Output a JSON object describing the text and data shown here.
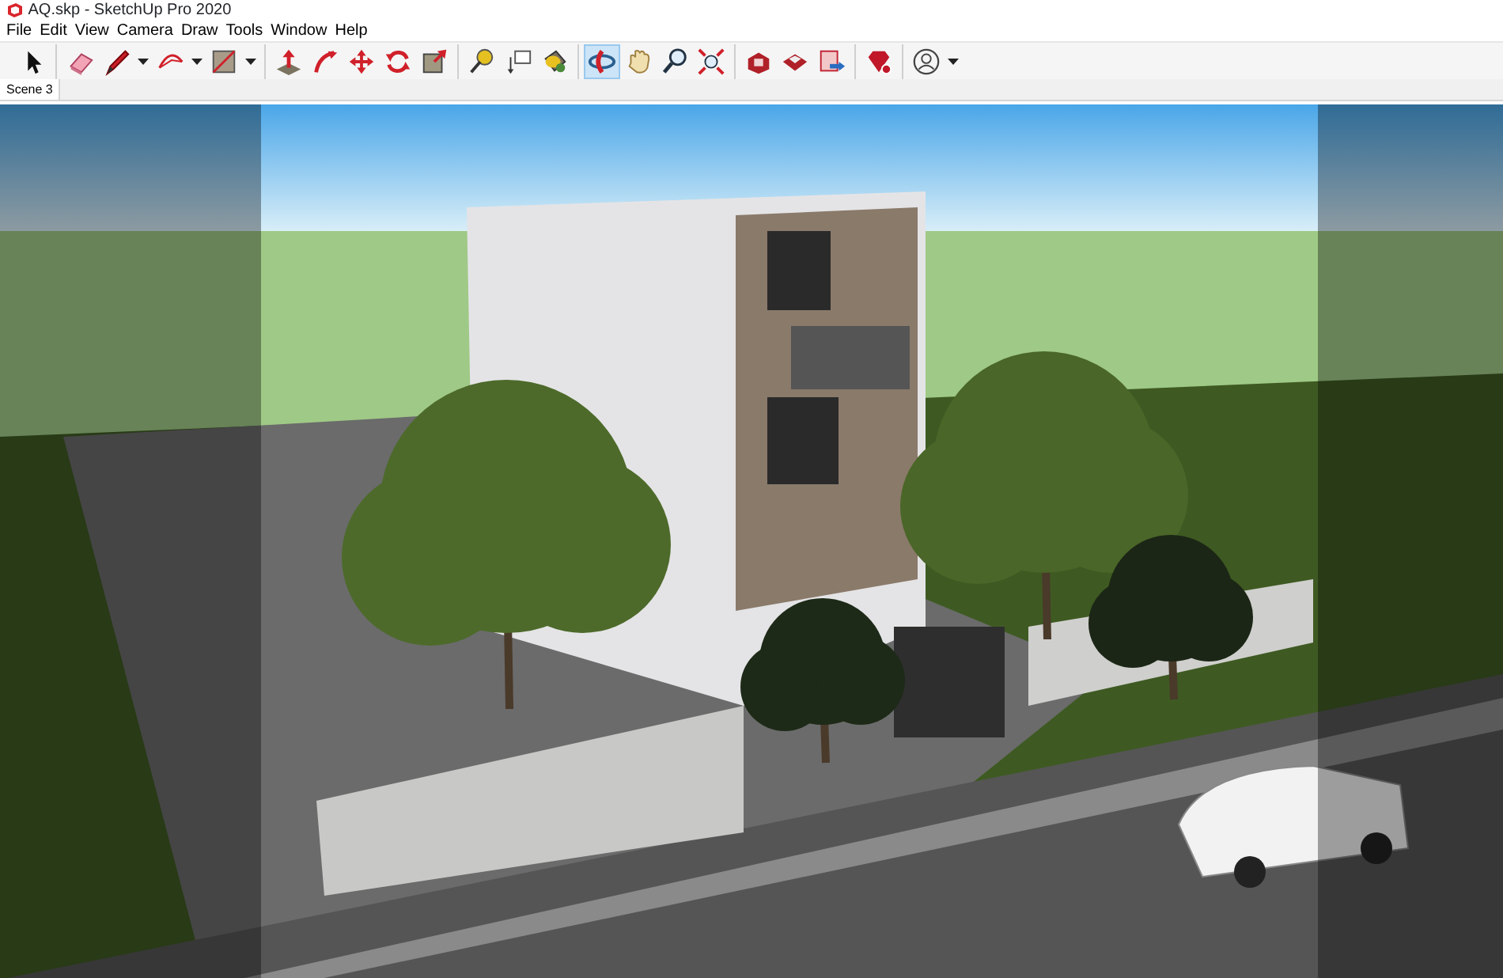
{
  "window": {
    "title": "AQ.skp - SketchUp Pro 2020"
  },
  "menu": [
    "File",
    "Edit",
    "View",
    "Camera",
    "Draw",
    "Tools",
    "Window",
    "Help"
  ],
  "toolbar": [
    [
      {
        "kind": "select",
        "selected": false
      }
    ],
    [
      {
        "kind": "eraser",
        "selected": false
      },
      {
        "kind": "pencil",
        "selected": false,
        "dropdown": true
      },
      {
        "kind": "arc",
        "selected": false,
        "dropdown": true
      },
      {
        "kind": "rectangle",
        "selected": false,
        "dropdown": true
      }
    ],
    [
      {
        "kind": "pushpull",
        "selected": false
      },
      {
        "kind": "followme",
        "selected": false
      },
      {
        "kind": "move",
        "selected": false
      },
      {
        "kind": "rotate",
        "selected": false
      },
      {
        "kind": "scale",
        "selected": false
      }
    ],
    [
      {
        "kind": "tape",
        "selected": false
      },
      {
        "kind": "text",
        "selected": false
      },
      {
        "kind": "paint",
        "selected": false
      }
    ],
    [
      {
        "kind": "orbit",
        "selected": true
      },
      {
        "kind": "pan",
        "selected": false
      },
      {
        "kind": "zoom",
        "selected": false
      },
      {
        "kind": "extents",
        "selected": false
      }
    ],
    [
      {
        "kind": "warehouse",
        "selected": false
      },
      {
        "kind": "extension",
        "selected": false
      },
      {
        "kind": "export",
        "selected": false
      }
    ],
    [
      {
        "kind": "ruby",
        "selected": false
      }
    ],
    [
      {
        "kind": "account",
        "selected": false,
        "dropdown": true
      }
    ]
  ],
  "scenes": [
    {
      "label": "Scene 3",
      "selected": true
    }
  ]
}
